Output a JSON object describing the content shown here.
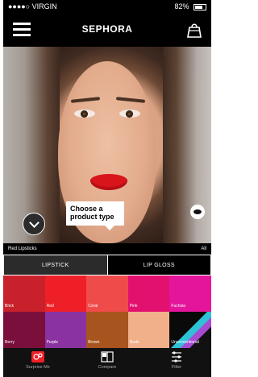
{
  "status_bar": {
    "carrier": "●●●●○ VIRGIN",
    "battery": "82%"
  },
  "nav": {
    "title": "SEPHORA"
  },
  "photo": {
    "tooltip_line1": "Choose a",
    "tooltip_line2": "product type"
  },
  "selection": {
    "left": "Red Lipsticks",
    "right": "All"
  },
  "tabs": {
    "lipstick": "LIPSTICK",
    "lip_gloss": "LIP GLOSS"
  },
  "swatches": [
    {
      "name": "Brick",
      "color": "#c8212b"
    },
    {
      "name": "Red",
      "color": "#ef1f27"
    },
    {
      "name": "Coral",
      "color": "#f04b4b"
    },
    {
      "name": "Pink",
      "color": "#e2106f"
    },
    {
      "name": "Fuchsia",
      "color": "#e5159b"
    },
    {
      "name": "Berry",
      "color": "#7a0f3b"
    },
    {
      "name": "Purple",
      "color": "#8a33a0"
    },
    {
      "name": "Brown",
      "color": "#a8541e"
    },
    {
      "name": "Nude",
      "color": "#f1b08a"
    },
    {
      "name": "Unconventional",
      "color": "#0a0a0a"
    }
  ],
  "bottom_nav": {
    "surprise": "Surprise Me",
    "compare": "Compare",
    "filter": "Filter"
  }
}
